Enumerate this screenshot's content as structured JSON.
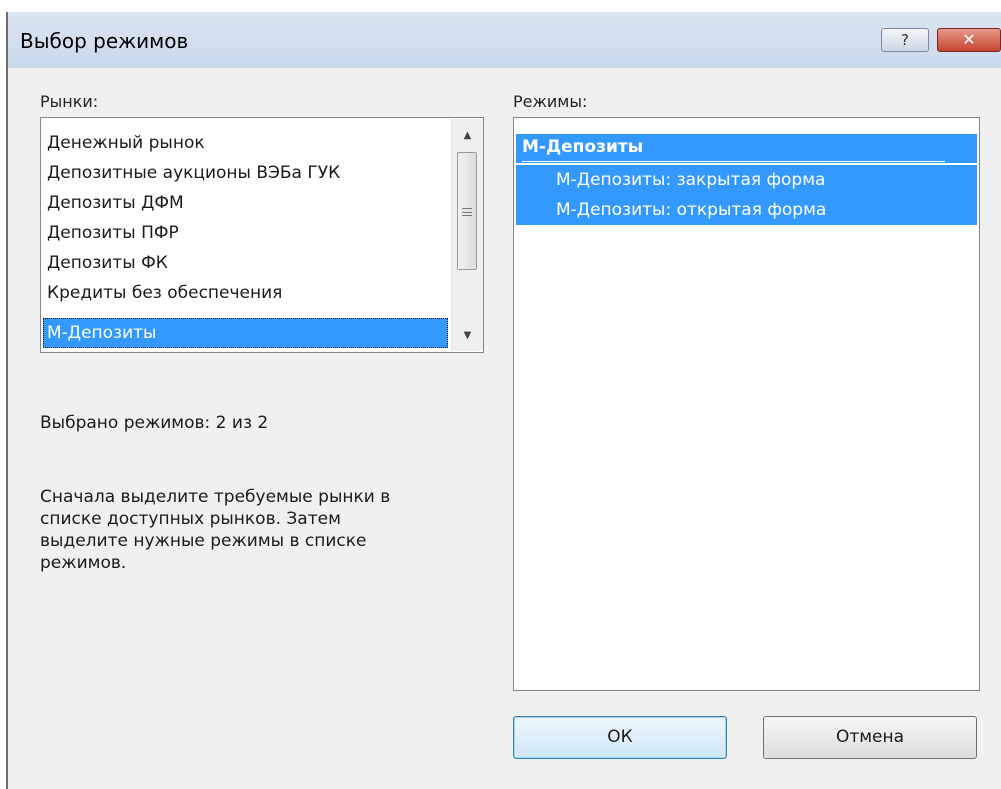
{
  "window": {
    "title": "Выбор режимов",
    "help_label": "?",
    "close_label": "✕"
  },
  "markets": {
    "label": "Рынки:",
    "items": [
      "Денежный рынок",
      "Депозитные аукционы ВЭБа ГУК",
      "Депозиты ДФМ",
      "Депозиты ПФР",
      "Депозиты ФК",
      "Кредиты без обеспечения",
      "М-Депозиты"
    ],
    "selected_index": 6,
    "scroll_up_icon": "▲",
    "scroll_down_icon": "▼"
  },
  "modes": {
    "label": "Режимы:",
    "group": "М-Депозиты",
    "items": [
      "М-Депозиты: закрытая форма",
      "М-Депозиты: открытая форма"
    ]
  },
  "status": {
    "selected_count_text": "Выбрано режимов: 2 из 2"
  },
  "instructions": {
    "line1": "Сначала выделите требуемые рынки в",
    "line2": "списке доступных рынков. Затем",
    "line3": "выделите нужные режимы в списке",
    "line4": "режимов."
  },
  "buttons": {
    "ok": "ОК",
    "cancel": "Отмена"
  },
  "colors": {
    "selection": "#3399ff",
    "dialog_bg": "#f0f0f0",
    "close_button": "#c5442f"
  }
}
